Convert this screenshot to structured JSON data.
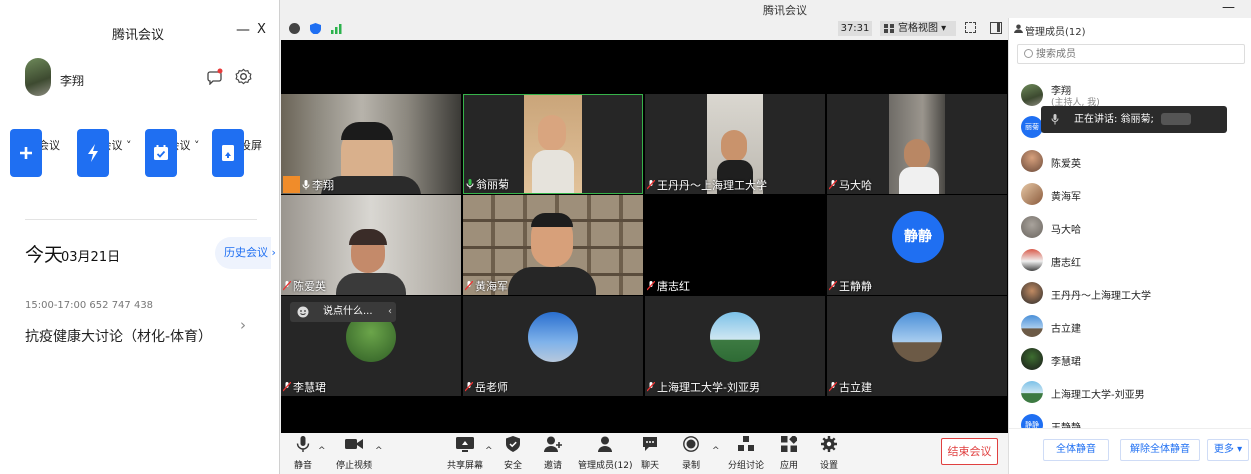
{
  "left": {
    "title": "腾讯会议",
    "min": "—",
    "close": "X",
    "user_name": "李翔",
    "quick_actions": [
      {
        "label": "加入会议",
        "icon": "plus-icon"
      },
      {
        "label": "快速会议 ˅",
        "icon": "lightning-icon"
      },
      {
        "label": "预定会议 ˅",
        "icon": "calendar-icon"
      },
      {
        "label": "无线投屏",
        "icon": "screen-cast-icon"
      }
    ],
    "today": "今天",
    "today_date": "03月21日",
    "history": "历史会议 ›",
    "meeting_time": "15:00-17:00  652 747 438",
    "meeting_title": "抗疫健康大讨论（材化-体育）",
    "chevron": "›"
  },
  "meeting": {
    "title": "腾讯会议",
    "min": "—",
    "timer": "37:31",
    "view_mode": "宫格视图 ▾",
    "say_placeholder": "说点什么...",
    "tiles": [
      {
        "name": "李翔"
      },
      {
        "name": "翁丽菊"
      },
      {
        "name": "王丹丹～上海理工大学"
      },
      {
        "name": "马大哈"
      },
      {
        "name": "陈爱英"
      },
      {
        "name": "黄海军"
      },
      {
        "name": "唐志红"
      },
      {
        "name": "王静静",
        "avatar_text": "静静"
      },
      {
        "name": "李慧珺"
      },
      {
        "name": "岳老师"
      },
      {
        "name": "上海理工大学-刘亚男"
      },
      {
        "name": "古立建"
      }
    ],
    "toolbar": [
      {
        "label": "静音"
      },
      {
        "label": "停止视频"
      },
      {
        "label": "共享屏幕"
      },
      {
        "label": "安全"
      },
      {
        "label": "邀请"
      },
      {
        "label": "管理成员(12)"
      },
      {
        "label": "聊天"
      },
      {
        "label": "录制"
      },
      {
        "label": "分组讨论"
      },
      {
        "label": "应用"
      },
      {
        "label": "设置"
      }
    ],
    "end_meeting": "结束会议"
  },
  "panel": {
    "title": "管理成员(12)",
    "search_placeholder": "搜索成员",
    "host_name": "李翔",
    "host_sub": "(主持人, 我)",
    "speaking_tooltip": "正在讲话: 翁丽菊;",
    "partial_avatar": "丽菊",
    "members": [
      "陈爱英",
      "黄海军",
      "马大哈",
      "唐志红",
      "王丹丹～上海理工大学",
      "古立建",
      "李慧珺",
      "上海理工大学-刘亚男",
      "王静静"
    ],
    "last_avatar_text": "静静",
    "mute_all": "全体静音",
    "unmute_all": "解除全体静音",
    "more": "更多 ▾"
  }
}
